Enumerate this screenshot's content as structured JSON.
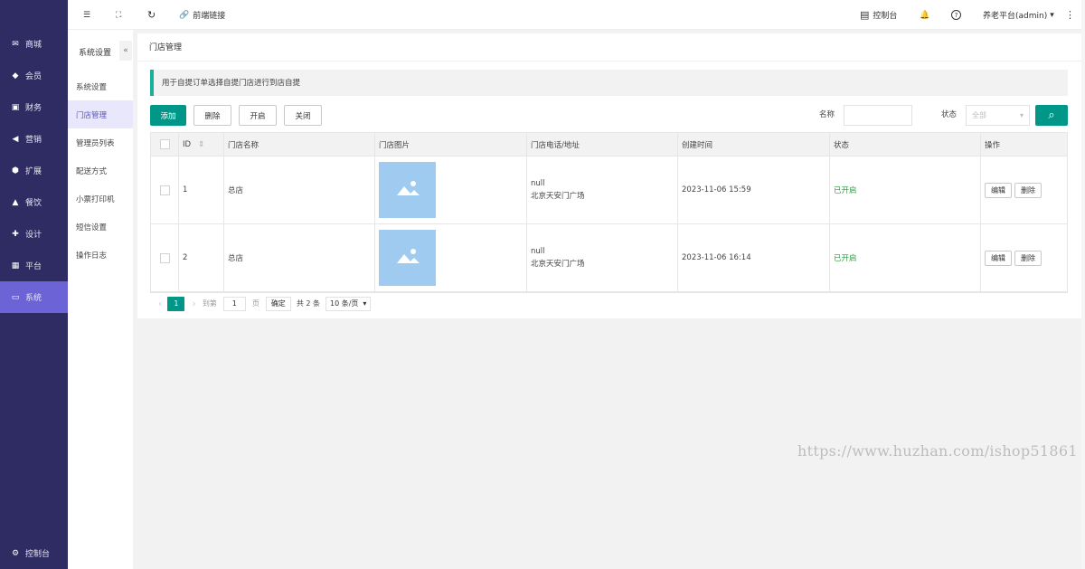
{
  "sidebar": {
    "items": [
      {
        "label": "商城",
        "icon": "mail-icon",
        "glyph": "✉"
      },
      {
        "label": "会员",
        "icon": "diamond-icon",
        "glyph": "◆"
      },
      {
        "label": "财务",
        "icon": "wallet-icon",
        "glyph": "▣"
      },
      {
        "label": "营销",
        "icon": "megaphone-icon",
        "glyph": "◀"
      },
      {
        "label": "扩展",
        "icon": "cube-icon",
        "glyph": "⬢"
      },
      {
        "label": "餐饮",
        "icon": "cloche-icon",
        "glyph": "▲"
      },
      {
        "label": "设计",
        "icon": "puzzle-icon",
        "glyph": "✚"
      },
      {
        "label": "平台",
        "icon": "grid-icon",
        "glyph": "▦"
      },
      {
        "label": "系统",
        "icon": "monitor-icon",
        "glyph": "▭"
      }
    ],
    "active_index": 8,
    "footer_label": "控制台",
    "footer_glyph": "⚙"
  },
  "subnav": {
    "title": "系统设置",
    "collapse_glyph": "«",
    "items": [
      "系统设置",
      "门店管理",
      "管理员列表",
      "配送方式",
      "小票打印机",
      "短信设置",
      "操作日志"
    ],
    "active_index": 1
  },
  "topbar": {
    "menu_glyph": "☰",
    "fullscreen_glyph": "⛶",
    "refresh_glyph": "↻",
    "link_glyph": "🔗",
    "link_label": "前端链接",
    "console_glyph": "▤",
    "console_label": "控制台",
    "bell_glyph": "🔔",
    "help_glyph": "?",
    "user_label": "养老平台(admin)",
    "caret_glyph": "▾",
    "more_glyph": "⋮"
  },
  "page": {
    "title": "门店管理",
    "notice": "用于自提订单选择自提门店进行到店自提"
  },
  "toolbar": {
    "add": "添加",
    "delete": "删除",
    "enable": "开启",
    "disable": "关闭",
    "name_label": "名称",
    "name_value": "",
    "status_label": "状态",
    "status_value": "全部",
    "search_glyph": "⌕"
  },
  "table": {
    "columns": [
      "ID",
      "门店名称",
      "门店图片",
      "门店电话/地址",
      "创建时间",
      "状态",
      "操作"
    ],
    "sort_glyph": "⇕",
    "rows": [
      {
        "id": "1",
        "name": "总店",
        "phone": "null",
        "address": "北京天安门广场",
        "created": "2023-11-06 15:59",
        "status": "已开启",
        "edit": "编辑",
        "delete": "删除"
      },
      {
        "id": "2",
        "name": "总店",
        "phone": "null",
        "address": "北京天安门广场",
        "created": "2023-11-06 16:14",
        "status": "已开启",
        "edit": "编辑",
        "delete": "删除"
      }
    ]
  },
  "pager": {
    "prev": "‹",
    "current": "1",
    "next": "›",
    "goto_label": "到第",
    "goto_value": "1",
    "page_unit": "页",
    "confirm": "确定",
    "total": "共 2 条",
    "per_page": "10 条/页"
  },
  "watermark": "https://www.huzhan.com/ishop51861",
  "colors": {
    "sidebar": "#2f2b63",
    "sidebar_active": "#6c63d6",
    "primary": "#009688",
    "status_on": "#2e9e44"
  }
}
